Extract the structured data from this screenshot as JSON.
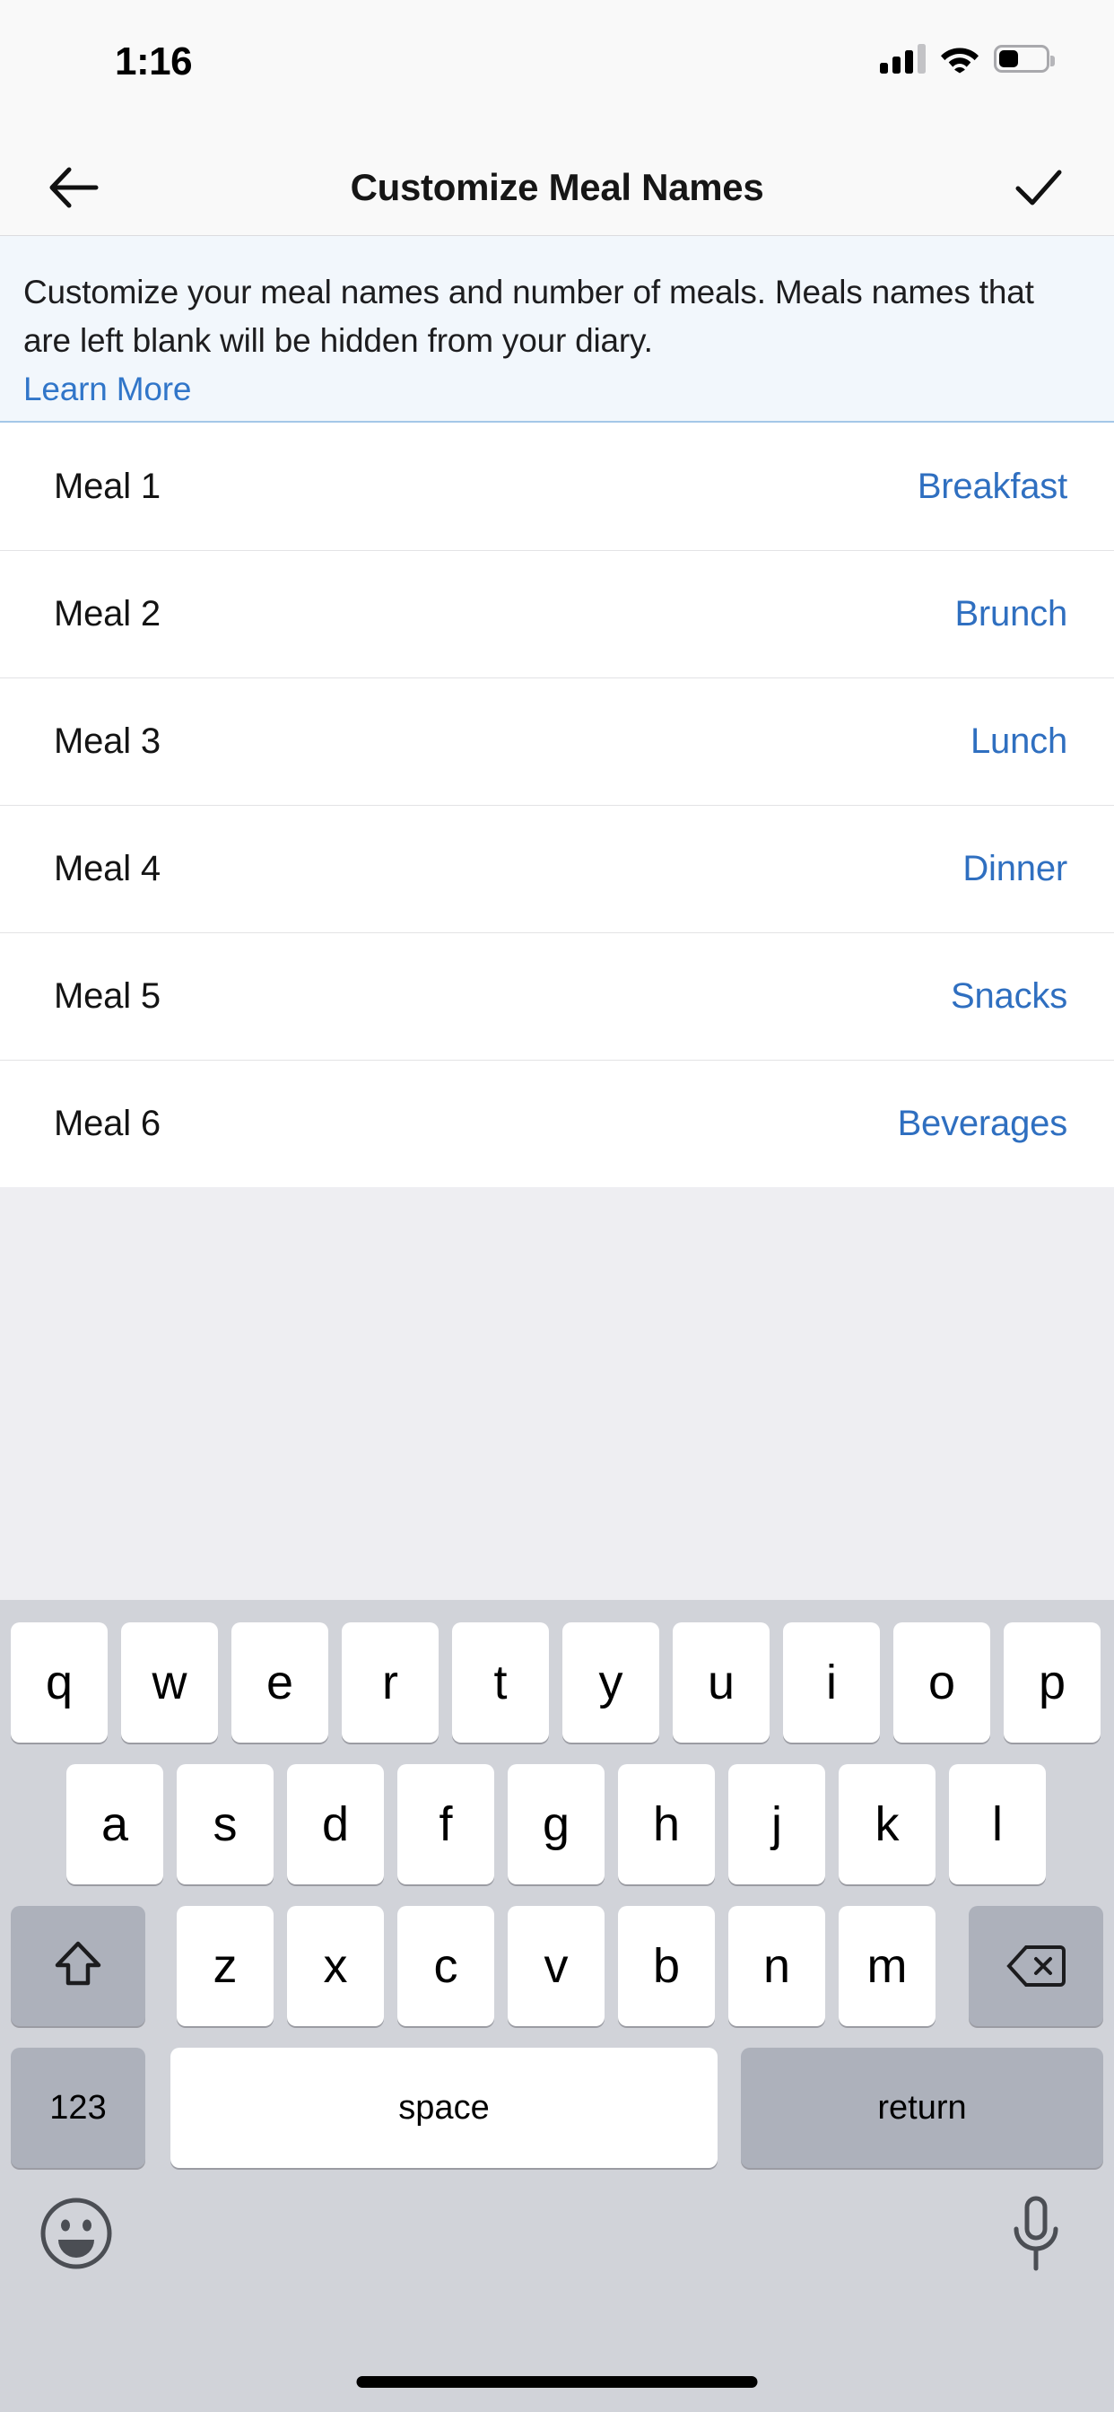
{
  "status_bar": {
    "time": "1:16",
    "cellular_icon": "cellular-signal-icon",
    "cellular_bars_filled": 3,
    "cellular_bars_total": 4,
    "wifi_icon": "wifi-icon",
    "battery_icon": "battery-icon",
    "battery_level_percent": 40
  },
  "nav_bar": {
    "back_icon": "back-arrow-icon",
    "title": "Customize Meal Names",
    "confirm_icon": "checkmark-icon"
  },
  "info_banner": {
    "text": "Customize your meal names and number of meals. Meals names that are left blank will be hidden from your diary.",
    "link_label": "Learn More",
    "background_color": "#f2f7fc",
    "link_color": "#3176c9"
  },
  "meal_list": {
    "accent_color": "#2f6fc0",
    "rows": [
      {
        "label": "Meal 1",
        "value": "Breakfast"
      },
      {
        "label": "Meal 2",
        "value": "Brunch"
      },
      {
        "label": "Meal 3",
        "value": "Lunch"
      },
      {
        "label": "Meal 4",
        "value": "Dinner"
      },
      {
        "label": "Meal 5",
        "value": "Snacks"
      },
      {
        "label": "Meal 6",
        "value": "Beverages"
      }
    ]
  },
  "keyboard": {
    "background_color": "#d1d3d9",
    "row1": [
      "q",
      "w",
      "e",
      "r",
      "t",
      "y",
      "u",
      "i",
      "o",
      "p"
    ],
    "row2": [
      "a",
      "s",
      "d",
      "f",
      "g",
      "h",
      "j",
      "k",
      "l"
    ],
    "row3": [
      "z",
      "x",
      "c",
      "v",
      "b",
      "n",
      "m"
    ],
    "shift_icon": "shift-arrow-icon",
    "backspace_icon": "backspace-delete-icon",
    "numbers_key_label": "123",
    "space_key_label": "space",
    "return_key_label": "return",
    "emoji_icon": "emoji-smiley-icon",
    "dictation_icon": "microphone-icon"
  },
  "home_indicator": "home-indicator-bar"
}
